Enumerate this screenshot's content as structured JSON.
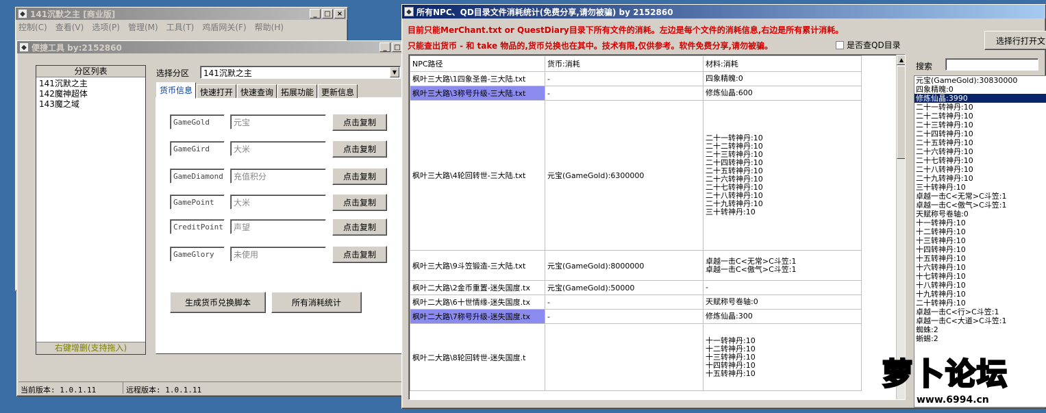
{
  "main_window": {
    "title": "141沉默之主 [商业版]",
    "menu": [
      "控制(C)",
      "查看(V)",
      "选项(P)",
      "管理(M)",
      "工具(T)",
      "鸡盾网关(F)",
      "帮助(H)"
    ]
  },
  "tool_window": {
    "title": "便捷工具  by:2152860",
    "partition_list_header": "分区列表",
    "partitions": [
      "141沉默之主",
      "142魔神超体",
      "143魔之域"
    ],
    "partition_footer": "右键增删(支持拖入)",
    "select_label": "选择分区",
    "select_value": "141沉默之主",
    "tabs": [
      "货币信息",
      "快速打开",
      "快速查询",
      "拓展功能",
      "更新信息"
    ],
    "currency_rows": [
      {
        "code": "GameGold",
        "name": "元宝",
        "button": "点击复制"
      },
      {
        "code": "GameGird",
        "name": "大米",
        "button": "点击复制"
      },
      {
        "code": "GameDiamond",
        "name": "充值积分",
        "button": "点击复制"
      },
      {
        "code": "GamePoint",
        "name": "大米",
        "button": "点击复制"
      },
      {
        "code": "CreditPoint",
        "name": "声望",
        "button": "点击复制"
      },
      {
        "code": "GameGlory",
        "name": "未使用",
        "button": "点击复制"
      }
    ],
    "gen_script_button": "生成货币兑换脚本",
    "all_stats_button": "所有消耗统计",
    "current_version": "当前版本: 1.0.1.11",
    "remote_version": "远程版本: 1.0.1.11"
  },
  "stats_window": {
    "title": "所有NPC、QD目录文件消耗统计(免费分享,请勿被骗)    by 2152860",
    "notice1": "目前只能MerChant.txt or QuestDiary目录下所有文件的消耗。左边是每个文件的消耗信息,右边是所有累计消耗。",
    "notice2": "只能查出货币 - 和 take 物品的,货币兑换也在其中。技术有限,仅供参考。软件免费分享,请勿被骗。",
    "checkbox_label": "是否查QD目录",
    "open_button": "选择行打开文",
    "search_label": "搜索",
    "columns": [
      "NPC路径",
      "货币:消耗",
      "材料:消耗"
    ],
    "rows": [
      {
        "path": "枫叶三大路\\1四象圣兽-三大陆.txt",
        "currency": "-",
        "materials": [
          "四象精魄:0"
        ]
      },
      {
        "path": "枫叶三大路\\3称号升级-三大陆.txt",
        "currency": "-",
        "materials": [
          "修炼仙晶:600"
        ],
        "highlight": true
      },
      {
        "path": "枫叶三大路\\4轮回转世-三大陆.txt",
        "currency": "元宝(GameGold):6300000",
        "materials": [
          "二十一转神丹:10",
          "二十二转神丹:10",
          "二十三转神丹:10",
          "二十四转神丹:10",
          "二十五转神丹:10",
          "二十六转神丹:10",
          "二十七转神丹:10",
          "二十八转神丹:10",
          "二十九转神丹:10",
          "三十转神丹:10"
        ]
      },
      {
        "path": "枫叶三大路\\9斗笠锻造-三大陆.txt",
        "currency": "元宝(GameGold):8000000",
        "materials": [
          "卓越一击C<无常>C斗笠:1",
          "卓越一击C<傲气>C斗笠:1"
        ]
      },
      {
        "path": "枫叶二大路\\2金币重置-迷失国度.tx",
        "currency": "元宝(GameGold):50000",
        "materials": [
          "-"
        ]
      },
      {
        "path": "枫叶二大路\\6十世情缘-迷失国度.tx",
        "currency": "-",
        "materials": [
          "天赋称号卷轴:0"
        ]
      },
      {
        "path": "枫叶二大路\\7称号升级-迷失国度.tx",
        "currency": "-",
        "materials": [
          "修炼仙晶:300"
        ],
        "highlight": true
      },
      {
        "path": "枫叶二大路\\8轮回转世-迷失国度.t",
        "currency": "",
        "materials": [
          "十一转神丹:10",
          "十二转神丹:10",
          "十三转神丹:10",
          "十四转神丹:10",
          "十五转神丹:10"
        ]
      }
    ],
    "totals": [
      "元宝(GameGold):30830000",
      "四象精魄:0",
      "修炼仙晶:3990",
      "二十一转神丹:10",
      "二十二转神丹:10",
      "二十三转神丹:10",
      "二十四转神丹:10",
      "二十五转神丹:10",
      "二十六转神丹:10",
      "二十七转神丹:10",
      "二十八转神丹:10",
      "二十九转神丹:10",
      "三十转神丹:10",
      "卓越一击C<无常>C斗笠:1",
      "卓越一击C<傲气>C斗笠:1",
      "天赋称号卷轴:0",
      "十一转神丹:10",
      "十二转神丹:10",
      "十三转神丹:10",
      "十四转神丹:10",
      "十五转神丹:10",
      "十六转神丹:10",
      "十七转神丹:10",
      "十八转神丹:10",
      "十九转神丹:10",
      "二十转神丹:10",
      "卓越一击C<行>C斗笠:1",
      "卓越一击C<大道>C斗笠:1",
      "蜘蛛:2",
      "蜥蜴:2"
    ],
    "totals_selected_index": 2
  },
  "watermark": {
    "text": "萝卜论坛",
    "url": "www.6994.cn"
  },
  "colors": {
    "title_active": "#0a246a",
    "notice_red": "#d40000",
    "highlight_row": "#8a8aef",
    "desktop": "#3a6ea5"
  }
}
